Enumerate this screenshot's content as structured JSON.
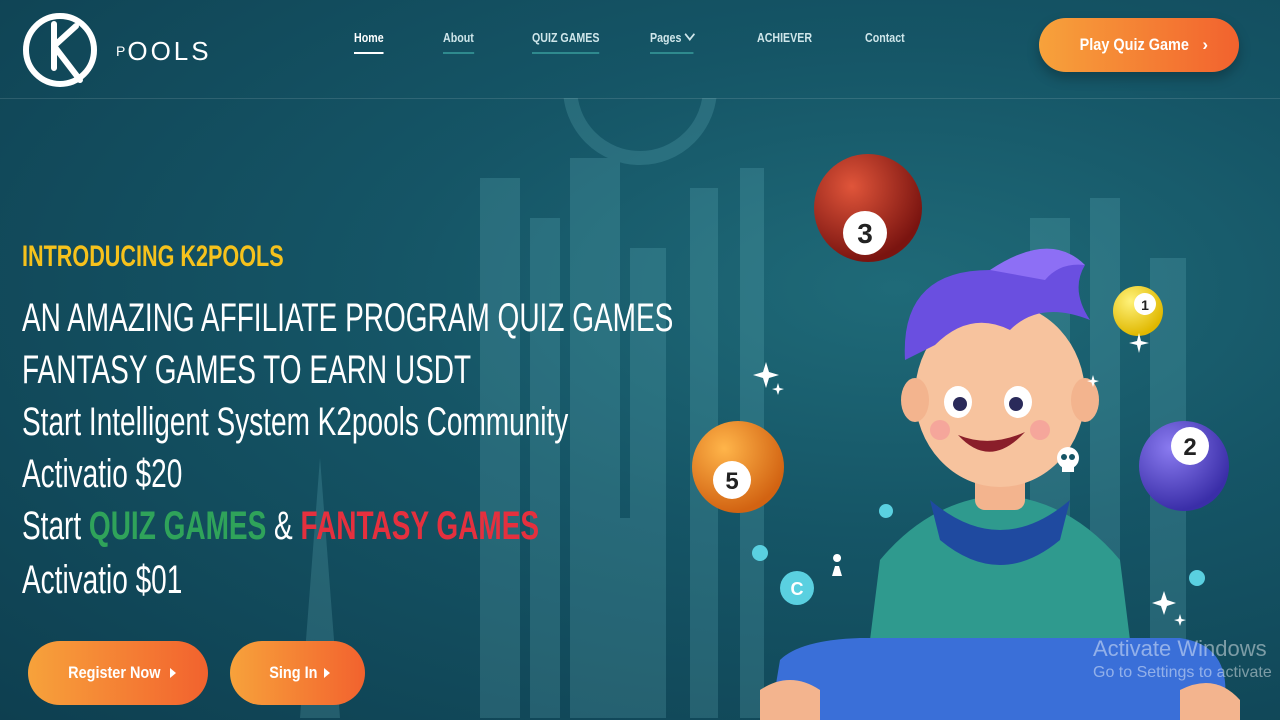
{
  "brand": {
    "logo_letter": "K",
    "logo_small": "P",
    "logo_text": "OOLS"
  },
  "nav": {
    "home": "Home",
    "about": "About",
    "quiz_games": "QUIZ GAMES",
    "pages": "Pages",
    "achiever": "ACHIEVER",
    "contact": "Contact"
  },
  "cta": {
    "play_quiz": "Play Quiz Game",
    "play_arrow": "›"
  },
  "hero": {
    "eyebrow": "INTRODUCING K2POOLS",
    "line1": "AN AMAZING AFFILIATE PROGRAM QUIZ GAMES",
    "line2": "FANTASY GAMES TO EARN USDT",
    "line3": "Start Intelligent System K2pools Community",
    "line4": "Activatio $20",
    "line5_start": "Start",
    "line5_quiz": "QUIZ GAMES",
    "line5_amp": "&",
    "line5_fantasy": "FANTASY GAMES",
    "line6": "Activatio  $01"
  },
  "buttons": {
    "register": "Register Now",
    "signin": "Sing In"
  },
  "balls": {
    "b3": "3",
    "b1": "1",
    "b5": "5",
    "b2": "2",
    "coin": "C"
  },
  "watermark": {
    "title": "Activate Windows",
    "subtitle": "Go to Settings to activate"
  },
  "colors": {
    "accent_orange": "#f2622e",
    "accent_yellow": "#f6c21c",
    "green": "#2fa35a",
    "red": "#e5303e"
  }
}
